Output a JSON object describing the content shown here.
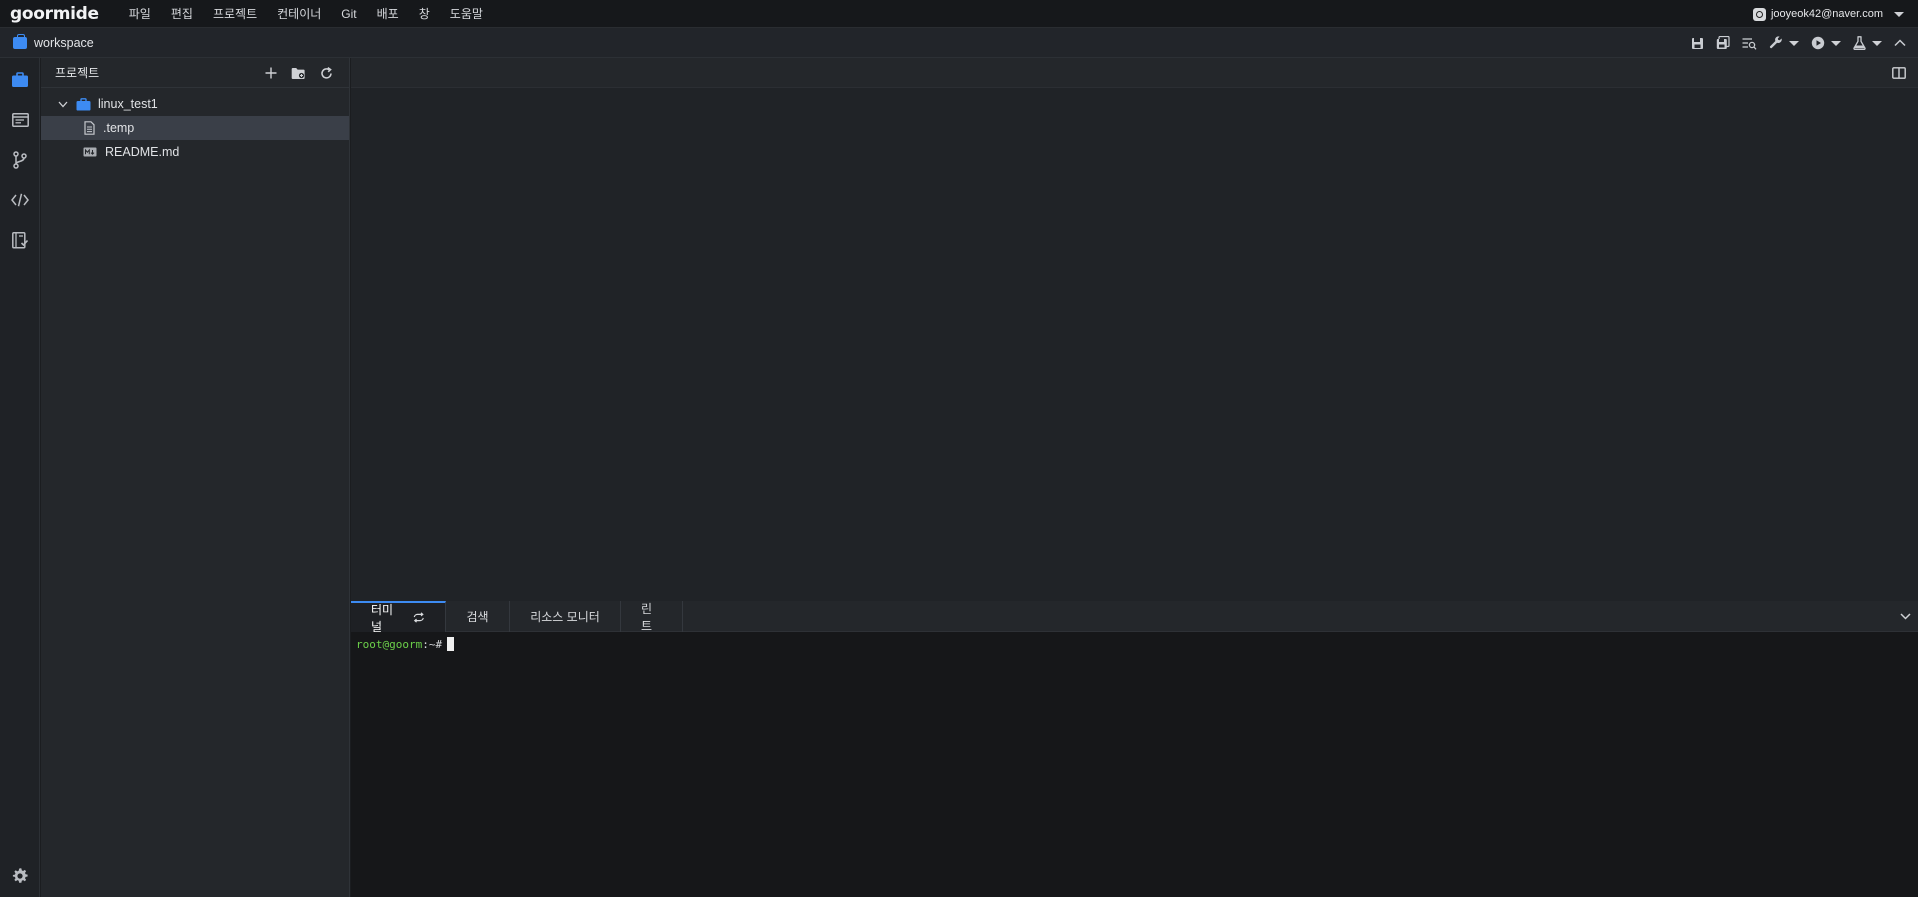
{
  "app": {
    "logo": "goormide"
  },
  "menu": [
    "파일",
    "편집",
    "프로젝트",
    "컨테이너",
    "Git",
    "배포",
    "창",
    "도움말"
  ],
  "user": {
    "email": "jooyeok42@naver.com"
  },
  "workspace": {
    "label": "workspace"
  },
  "sidebar": {
    "title": "프로젝트",
    "tree": [
      {
        "label": "linux_test1",
        "type": "folder",
        "icon": "folder-icon",
        "expanded": true
      },
      {
        "label": ".temp",
        "type": "file",
        "icon": "file-icon",
        "selected": true
      },
      {
        "label": "README.md",
        "type": "file",
        "icon": "markdown-icon"
      }
    ]
  },
  "panel": {
    "tabs": [
      "터미널",
      "검색",
      "리소스 모니터",
      "린트"
    ],
    "active_tab": "터미널"
  },
  "terminal": {
    "prompt_user": "root@goorm",
    "prompt_sep": ":~#"
  },
  "colors": {
    "accent": "#3d8bf2",
    "prompt_green": "#6cd14a"
  }
}
